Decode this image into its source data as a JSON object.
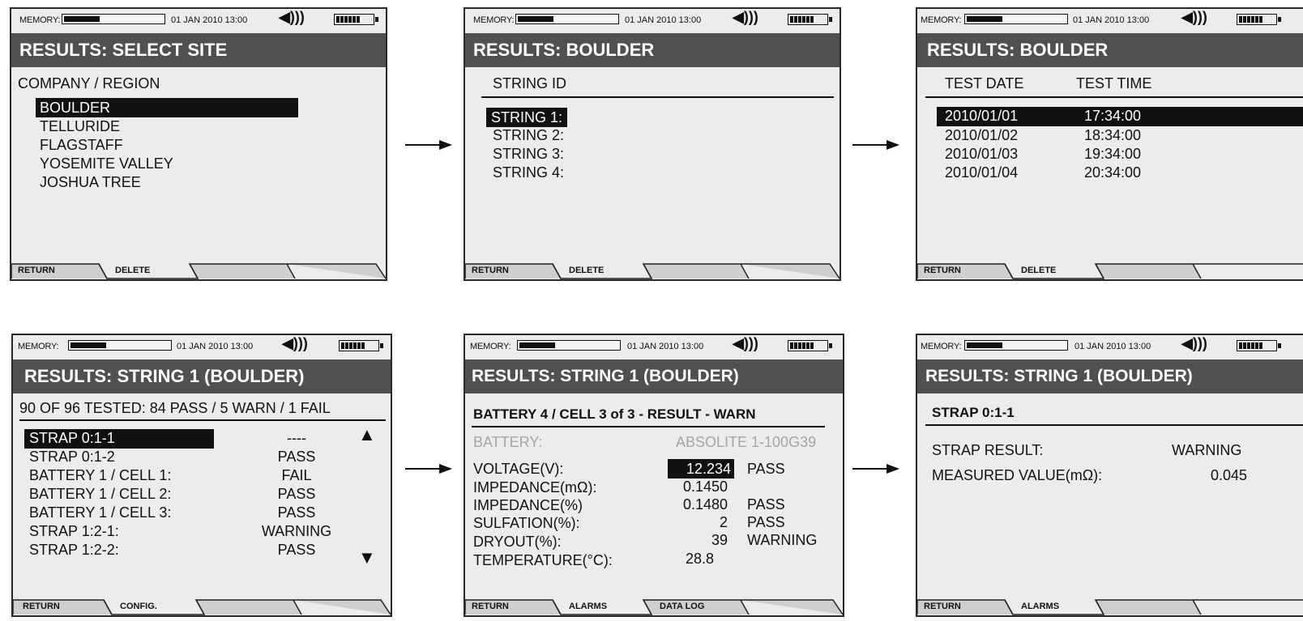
{
  "status": {
    "memory_label": "MEMORY:",
    "datetime": "01 JAN 2010 13:00",
    "speaker_waves": ")))"
  },
  "screens": [
    {
      "title": "RESULTS: SELECT SITE",
      "header": "COMPANY / REGION",
      "items": [
        "BOULDER",
        "TELLURIDE",
        "FLAGSTAFF",
        "YOSEMITE VALLEY",
        "JOSHUA TREE"
      ],
      "softkeys": [
        "RETURN",
        "DELETE",
        "",
        ""
      ]
    },
    {
      "title": "RESULTS: BOULDER",
      "header": "STRING ID",
      "items": [
        "STRING 1:",
        "STRING 2:",
        "STRING 3:",
        "STRING 4:"
      ],
      "softkeys": [
        "RETURN",
        "DELETE",
        "",
        ""
      ]
    },
    {
      "title": "RESULTS: BOULDER",
      "columns": [
        "TEST DATE",
        "TEST TIME"
      ],
      "rows": [
        [
          "2010/01/01",
          "17:34:00"
        ],
        [
          "2010/01/02",
          "18:34:00"
        ],
        [
          "2010/01/03",
          "19:34:00"
        ],
        [
          "2010/01/04",
          "20:34:00"
        ]
      ],
      "softkeys": [
        "RETURN",
        "DELETE",
        "",
        ""
      ]
    },
    {
      "title": "RESULTS: STRING 1 (BOULDER)",
      "summary": "90 OF 96 TESTED: 84 PASS / 5 WARN / 1 FAIL",
      "rows": [
        [
          "STRAP 0:1-1",
          "----"
        ],
        [
          "STRAP 0:1-2",
          "PASS"
        ],
        [
          "BATTERY 1 / CELL 1:",
          "FAIL"
        ],
        [
          "BATTERY 1 / CELL 2:",
          "PASS"
        ],
        [
          "BATTERY 1 / CELL 3:",
          "PASS"
        ],
        [
          "STRAP 1:2-1:",
          "WARNING"
        ],
        [
          "STRAP 1:2-2:",
          "PASS"
        ]
      ],
      "scroll_up": "▲",
      "scroll_down": "▼",
      "softkeys": [
        "RETURN",
        "CONFIG.",
        "",
        ""
      ]
    },
    {
      "title": "RESULTS: STRING 1 (BOULDER)",
      "heading": "BATTERY 4 / CELL 3 of 3 - RESULT - WARN",
      "battery_label": "BATTERY:",
      "battery_value": "ABSOLITE 1-100G39",
      "rows": [
        [
          "VOLTAGE(V):",
          "12.234",
          "PASS"
        ],
        [
          "IMPEDANCE(mΩ):",
          "0.1450",
          ""
        ],
        [
          "IMPEDANCE(%)",
          "0.1480",
          "PASS"
        ],
        [
          "SULFATION(%):",
          "2",
          "PASS"
        ],
        [
          "DRYOUT(%):",
          "39",
          "WARNING"
        ],
        [
          "TEMPERATURE(°C):",
          "28.8",
          ""
        ]
      ],
      "softkeys": [
        "RETURN",
        "ALARMS",
        "DATA LOG",
        ""
      ]
    },
    {
      "title": "RESULTS: STRING 1 (BOULDER)",
      "heading": "STRAP 0:1-1",
      "rows": [
        [
          "STRAP RESULT:",
          "WARNING"
        ],
        [
          "MEASURED VALUE(mΩ):",
          "0.045"
        ]
      ],
      "softkeys": [
        "RETURN",
        "ALARMS",
        "",
        ""
      ]
    }
  ]
}
